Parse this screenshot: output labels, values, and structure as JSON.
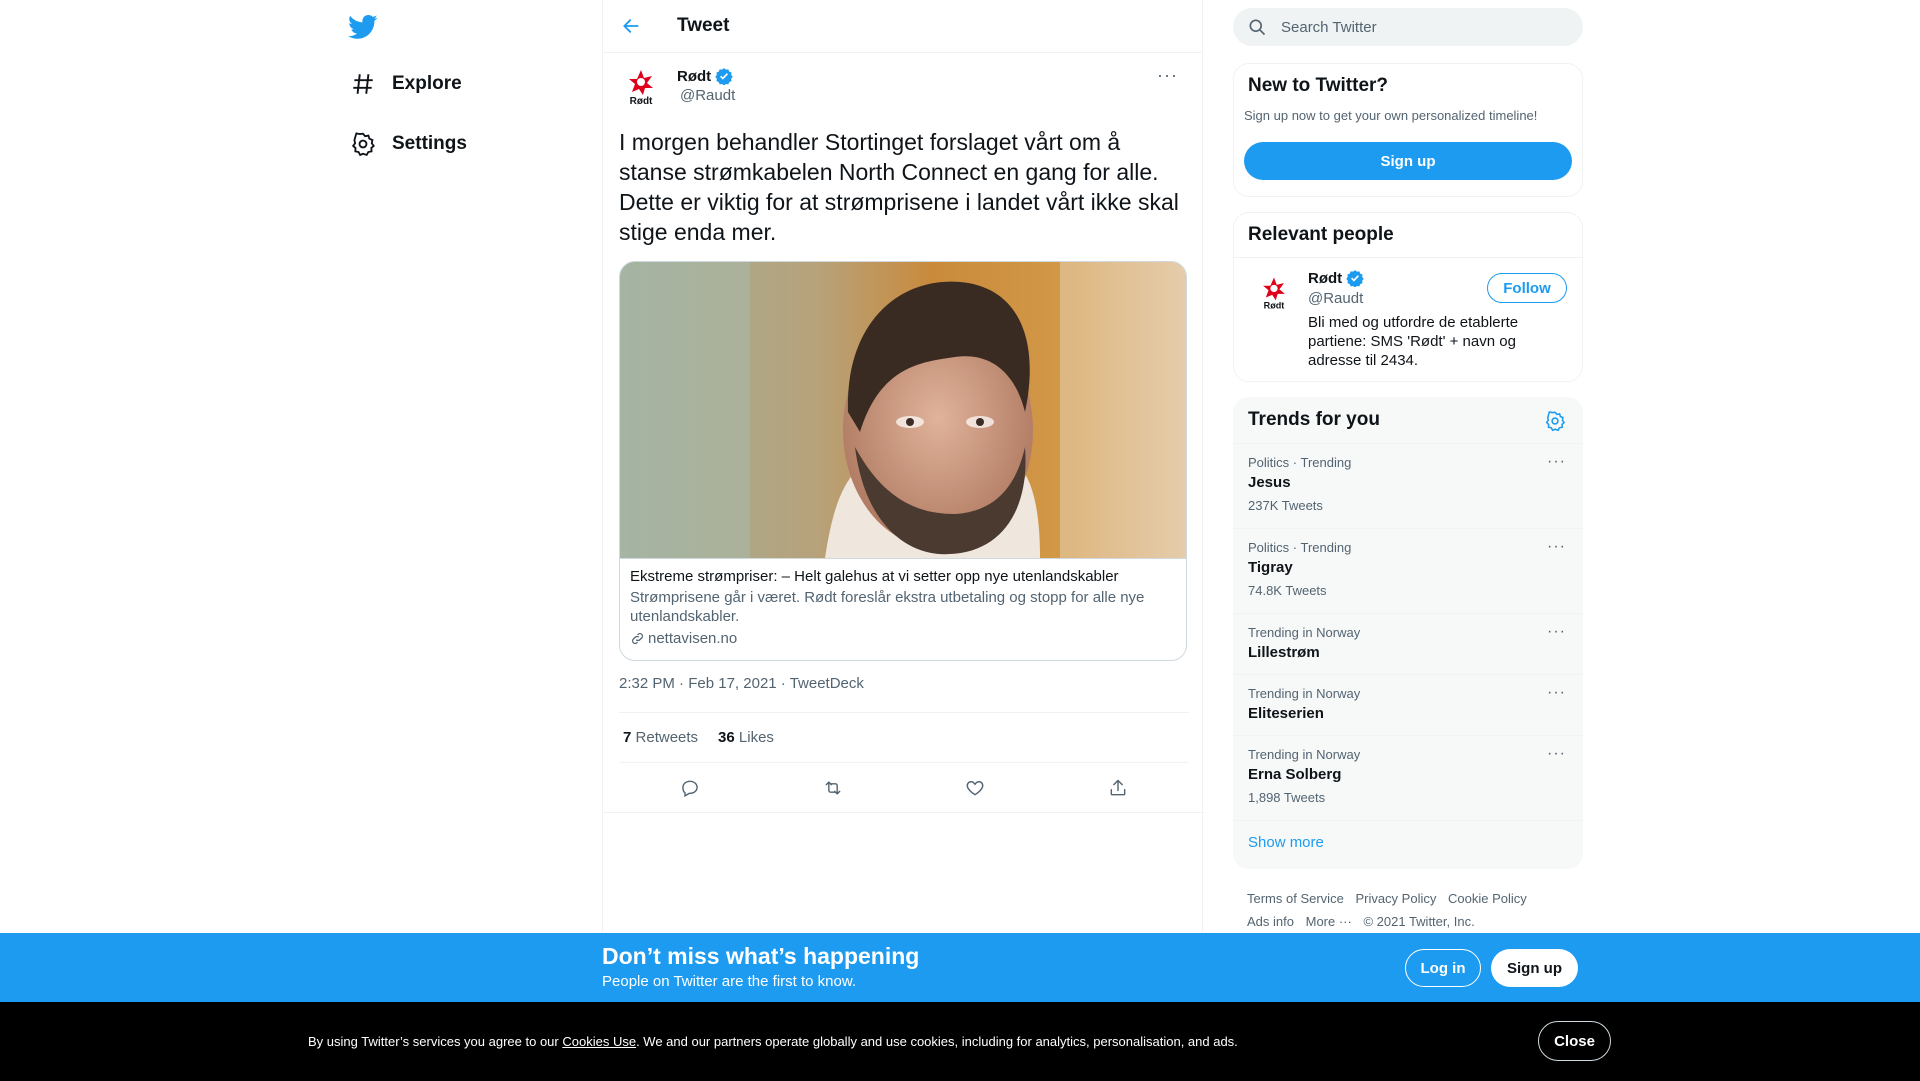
{
  "brand": {
    "accent": "#1d9bf0",
    "text": "#0f1419",
    "muted": "#536471",
    "party_red": "#e0001b"
  },
  "nav": {
    "logo_icon": "twitter-bird-icon",
    "items": [
      {
        "label": "Explore",
        "icon": "hashtag-icon"
      },
      {
        "label": "Settings",
        "icon": "gear-icon"
      }
    ]
  },
  "header": {
    "title": "Tweet",
    "back_icon": "arrow-left-icon"
  },
  "tweet": {
    "author_name": "Rødt",
    "author_handle": "@Raudt",
    "avatar_text": "Rødt",
    "verified_icon": "verified-badge-icon",
    "text": "I morgen behandler Stortinget forslaget vårt om å stanse strømkabelen North Connect en gang for alle. Dette er viktig for at strømprisene i landet vårt ikke skal stige enda mer.",
    "card": {
      "title": "Ekstreme strømpriser: – Helt galehus at vi setter opp nye utenlandskabler",
      "description": "Strømprisene går i været. Rødt foreslår ekstra utbetaling og stopp for alle nye utenlandskabler.",
      "domain": "nettavisen.no"
    },
    "time": "2:32 PM",
    "date": "Feb 17, 2021",
    "source": "TweetDeck",
    "retweets": "7",
    "retweets_label": "Retweets",
    "likes": "36",
    "likes_label": "Likes",
    "actions": [
      "reply-icon",
      "retweet-icon",
      "like-icon",
      "share-icon"
    ]
  },
  "search": {
    "placeholder": "Search Twitter"
  },
  "new_to_twitter": {
    "title": "New to Twitter?",
    "subtitle": "Sign up now to get your own personalized timeline!",
    "signup_label": "Sign up"
  },
  "relevant": {
    "title": "Relevant people",
    "name": "Rødt",
    "handle": "@Raudt",
    "follow_label": "Follow",
    "bio": "Bli med og utfordre de etablerte partiene: SMS 'Rødt' + navn og adresse til 2434."
  },
  "trends": {
    "title": "Trends for you",
    "items": [
      {
        "context": "Politics · Trending",
        "name": "Jesus",
        "count": "237K Tweets"
      },
      {
        "context": "Politics · Trending",
        "name": "Tigray",
        "count": "74.8K Tweets"
      },
      {
        "context": "Trending in Norway",
        "name": "Lillestrøm",
        "count": ""
      },
      {
        "context": "Trending in Norway",
        "name": "Eliteserien",
        "count": ""
      },
      {
        "context": "Trending in Norway",
        "name": "Erna Solberg",
        "count": "1,898 Tweets"
      }
    ],
    "show_more": "Show more"
  },
  "footer": {
    "links": [
      "Terms of Service",
      "Privacy Policy",
      "Cookie Policy",
      "Ads info",
      "More ···"
    ],
    "copyright": "© 2021 Twitter, Inc."
  },
  "banner": {
    "title": "Don’t miss what’s happening",
    "subtitle": "People on Twitter are the first to know.",
    "login_label": "Log in",
    "signup_label": "Sign up"
  },
  "cookie": {
    "text_before": "By using Twitter’s services you agree to our ",
    "link": "Cookies Use",
    "text_after": ". We and our partners operate globally and use cookies, including for analytics, personalisation, and ads.",
    "close_label": "Close"
  }
}
